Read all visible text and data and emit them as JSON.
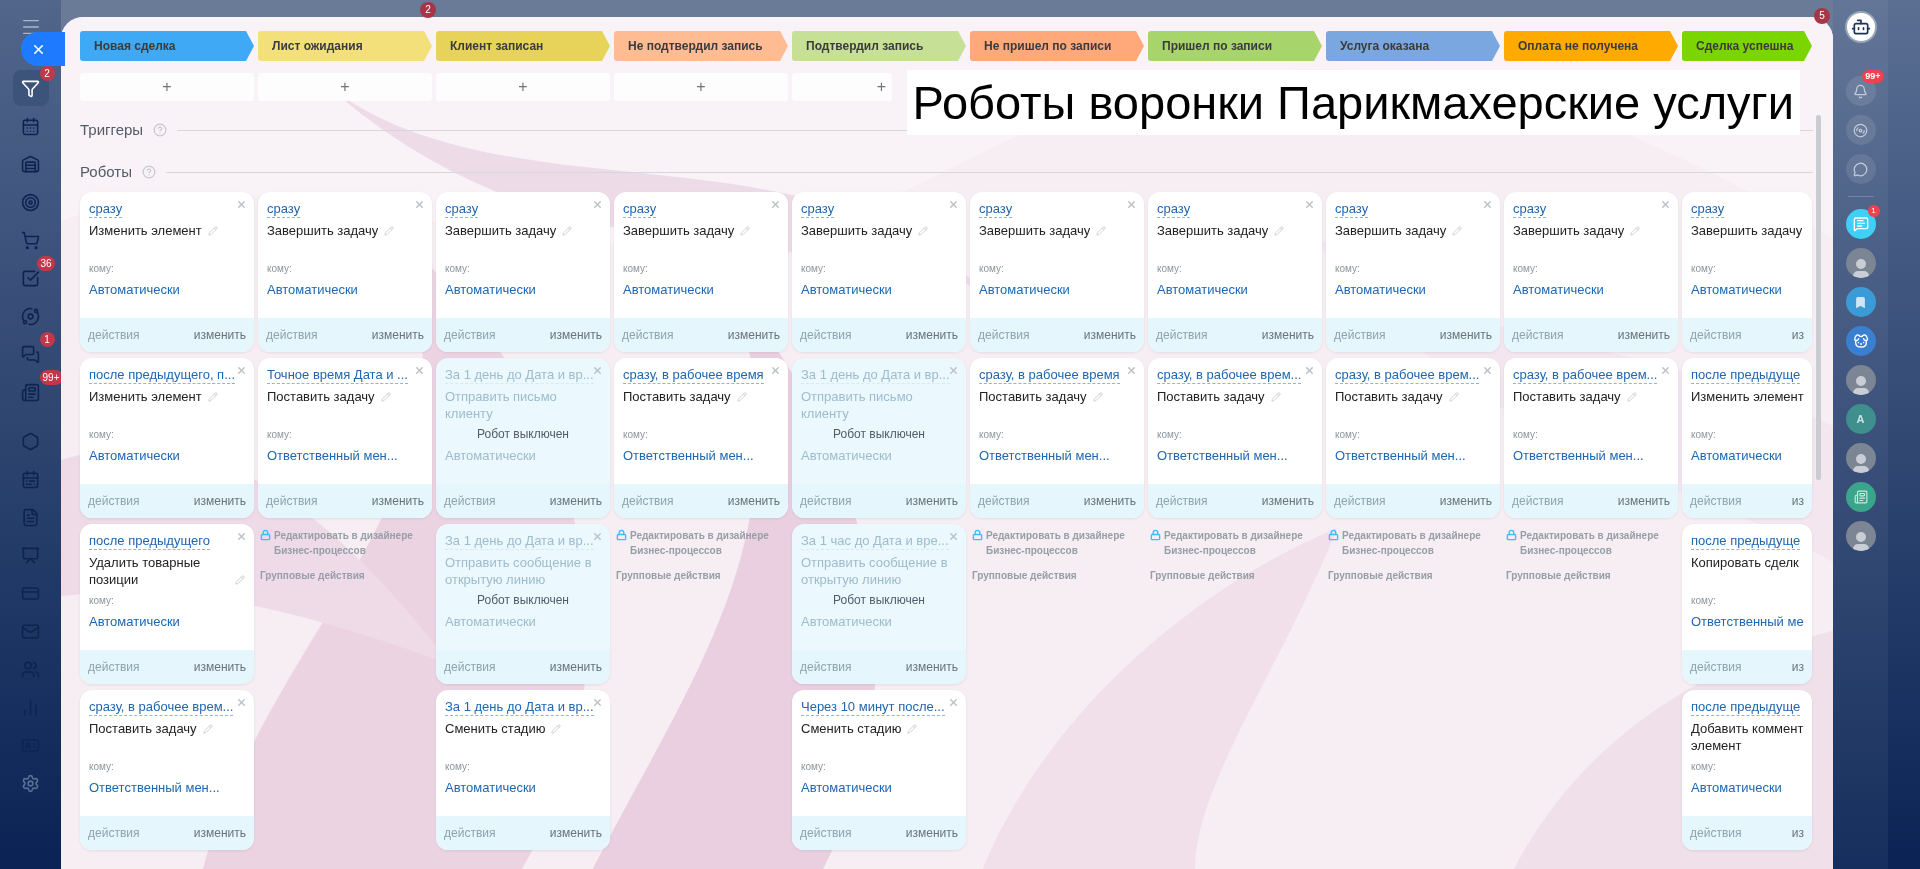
{
  "top_bar": {
    "badge": "2"
  },
  "left_sidebar": {
    "items": [
      {
        "selected": true,
        "badge": "2"
      },
      {
        "selected": false
      },
      {
        "selected": false
      },
      {
        "selected": false
      },
      {
        "selected": false
      },
      {
        "selected": false,
        "badge": "36"
      },
      {
        "selected": false
      },
      {
        "selected": false,
        "badge": "1"
      },
      {
        "selected": false,
        "badge": "99+"
      },
      {
        "selected": false
      },
      {
        "selected": false
      },
      {
        "selected": false
      },
      {
        "selected": false
      },
      {
        "selected": false
      },
      {
        "selected": false
      },
      {
        "selected": false
      },
      {
        "selected": false
      },
      {
        "selected": false
      },
      {
        "selected": false
      }
    ]
  },
  "stages": [
    {
      "label": "Новая сделка",
      "color": "#3fa9f5",
      "add": "+"
    },
    {
      "label": "Лист ожидания",
      "color": "#f3e07a",
      "add": "+"
    },
    {
      "label": "Клиент записан",
      "color": "#e8d35a",
      "add": "+"
    },
    {
      "label": "Не подтвердил запись",
      "color": "#ffbb91",
      "add": "+"
    },
    {
      "label": "Подтвердил запись",
      "color": "#c6e096",
      "add": "+"
    },
    {
      "label": "Не пришел по записи",
      "color": "#ffa97a"
    },
    {
      "label": "Пришел по записи",
      "color": "#a7d46b"
    },
    {
      "label": "Услуга оказана",
      "color": "#7ba7e0"
    },
    {
      "label": "Оплата не получена",
      "color": "#ffaa00"
    },
    {
      "label": "Сделка успешна",
      "color": "#7bd500"
    }
  ],
  "banner": "Роботы воронки Парикмахерские услуги",
  "triggers_title": "Триггеры",
  "robots_title": "Роботы",
  "columns": [
    {
      "robots": [
        {
          "timing": "сразу",
          "action": "Изменить элемент",
          "to_label": "кому:",
          "to": "Автоматически",
          "actions": "действия",
          "edit": "изменить",
          "disabled": false
        },
        {
          "timing": "после предыдущего, п...",
          "action": "Изменить элемент",
          "to_label": "кому:",
          "to": "Автоматически",
          "actions": "действия",
          "edit": "изменить",
          "disabled": false
        },
        {
          "timing": "после предыдущего",
          "action": "Удалить товарные позиции",
          "to_label": "кому:",
          "to": "Автоматически",
          "actions": "действия",
          "edit": "изменить",
          "disabled": false
        },
        {
          "timing": "сразу, в рабочее врем...",
          "action": "Поставить задачу",
          "to_label": "кому:",
          "to": "Ответственный мен...",
          "actions": "действия",
          "edit": "изменить",
          "disabled": false
        }
      ]
    },
    {
      "robots": [
        {
          "timing": "сразу",
          "action": "Завершить задачу",
          "to_label": "кому:",
          "to": "Автоматически",
          "actions": "действия",
          "edit": "изменить",
          "disabled": false
        },
        {
          "timing": "Точное время Дата и ...",
          "action": "Поставить задачу",
          "to_label": "кому:",
          "to": "Ответственный мен...",
          "actions": "действия",
          "edit": "изменить",
          "disabled": false
        }
      ],
      "footer": {
        "designer_link": "Редактировать в дизайнере Бизнес-процессов",
        "group_actions": "Групповые действия"
      }
    },
    {
      "robots": [
        {
          "timing": "сразу",
          "action": "Завершить задачу",
          "to_label": "кому:",
          "to": "Автоматически",
          "actions": "действия",
          "edit": "изменить",
          "disabled": false
        },
        {
          "timing": "За 1 день до Дата и вр...",
          "action": "Отправить письмо клиенту",
          "to": "Автоматически",
          "actions": "действия",
          "edit": "изменить",
          "disabled": true,
          "status": "Робот выключен"
        },
        {
          "timing": "За 1 день до Дата и вр...",
          "action": "Отправить сообщение в открытую линию",
          "to": "Автоматически",
          "actions": "действия",
          "edit": "изменить",
          "disabled": true,
          "status": "Робот выключен"
        },
        {
          "timing": "За 1 день до Дата и вр...",
          "action": "Сменить стадию",
          "to_label": "кому:",
          "to": "Автоматически",
          "actions": "действия",
          "edit": "изменить",
          "disabled": false
        }
      ]
    },
    {
      "robots": [
        {
          "timing": "сразу",
          "action": "Завершить задачу",
          "to_label": "кому:",
          "to": "Автоматически",
          "actions": "действия",
          "edit": "изменить",
          "disabled": false
        },
        {
          "timing": "сразу, в рабочее время",
          "action": "Поставить задачу",
          "to_label": "кому:",
          "to": "Ответственный мен...",
          "actions": "действия",
          "edit": "изменить",
          "disabled": false
        }
      ],
      "footer": {
        "designer_link": "Редактировать в дизайнере Бизнес-процессов",
        "group_actions": "Групповые действия"
      }
    },
    {
      "robots": [
        {
          "timing": "сразу",
          "action": "Завершить задачу",
          "to_label": "кому:",
          "to": "Автоматически",
          "actions": "действия",
          "edit": "изменить",
          "disabled": false
        },
        {
          "timing": "За 1 день до Дата и вр...",
          "action": "Отправить письмо клиенту",
          "to": "Автоматически",
          "actions": "действия",
          "edit": "изменить",
          "disabled": true,
          "status": "Робот выключен"
        },
        {
          "timing": "За 1 час до Дата и вре...",
          "action": "Отправить сообщение в открытую линию",
          "to": "Автоматически",
          "actions": "действия",
          "edit": "изменить",
          "disabled": true,
          "status": "Робот выключен"
        },
        {
          "timing": "Через 10 минут после...",
          "action": "Сменить стадию",
          "to_label": "кому:",
          "to": "Автоматически",
          "actions": "действия",
          "edit": "изменить",
          "disabled": false
        }
      ]
    },
    {
      "robots": [
        {
          "timing": "сразу",
          "action": "Завершить задачу",
          "to_label": "кому:",
          "to": "Автоматически",
          "actions": "действия",
          "edit": "изменить",
          "disabled": false
        },
        {
          "timing": "сразу, в рабочее время",
          "action": "Поставить задачу",
          "to_label": "кому:",
          "to": "Ответственный мен...",
          "actions": "действия",
          "edit": "изменить",
          "disabled": false
        }
      ],
      "footer": {
        "designer_link": "Редактировать в дизайнере Бизнес-процессов",
        "group_actions": "Групповые действия"
      }
    },
    {
      "robots": [
        {
          "timing": "сразу",
          "action": "Завершить задачу",
          "to_label": "кому:",
          "to": "Автоматически",
          "actions": "действия",
          "edit": "изменить",
          "disabled": false
        },
        {
          "timing": "сразу, в рабочее врем...",
          "action": "Поставить задачу",
          "to_label": "кому:",
          "to": "Ответственный мен...",
          "actions": "действия",
          "edit": "изменить",
          "disabled": false
        }
      ],
      "footer": {
        "designer_link": "Редактировать в дизайнере Бизнес-процессов",
        "group_actions": "Групповые действия"
      }
    },
    {
      "robots": [
        {
          "timing": "сразу",
          "action": "Завершить задачу",
          "to_label": "кому:",
          "to": "Автоматически",
          "actions": "действия",
          "edit": "изменить",
          "disabled": false
        },
        {
          "timing": "сразу, в рабочее врем...",
          "action": "Поставить задачу",
          "to_label": "кому:",
          "to": "Ответственный мен...",
          "actions": "действия",
          "edit": "изменить",
          "disabled": false
        }
      ],
      "footer": {
        "designer_link": "Редактировать в дизайнере Бизнес-процессов",
        "group_actions": "Групповые действия"
      }
    },
    {
      "robots": [
        {
          "timing": "сразу",
          "action": "Завершить задачу",
          "to_label": "кому:",
          "to": "Автоматически",
          "actions": "действия",
          "edit": "изменить",
          "disabled": false
        },
        {
          "timing": "сразу, в рабочее врем...",
          "action": "Поставить задачу",
          "to_label": "кому:",
          "to": "Ответственный мен...",
          "actions": "действия",
          "edit": "изменить",
          "disabled": false
        }
      ],
      "footer": {
        "designer_link": "Редактировать в дизайнере Бизнес-процессов",
        "group_actions": "Групповые действия"
      }
    },
    {
      "robots": [
        {
          "timing": "сразу",
          "action": "Завершить задачу",
          "to_label": "кому:",
          "to": "Автоматически",
          "actions": "действия",
          "edit": "из",
          "disabled": false
        },
        {
          "timing": "после предыдуще",
          "action": "Изменить элемент",
          "to_label": "кому:",
          "to": "Автоматически",
          "actions": "действия",
          "edit": "из",
          "disabled": false
        },
        {
          "timing": "после предыдуще",
          "action": "Копировать сделк",
          "to_label": "кому:",
          "to": "Ответственный ме",
          "actions": "действия",
          "edit": "из",
          "disabled": false
        },
        {
          "timing": "после предыдуще",
          "action": "Добавить коммент\nэлемент",
          "to_label": "кому:",
          "to": "Автоматически",
          "actions": "действия",
          "edit": "из",
          "disabled": false
        }
      ]
    }
  ],
  "right_sidebar": {
    "corner_badge": "5",
    "notifications_badge": "99+",
    "chat_badge": "1",
    "contact_letter": "A"
  }
}
